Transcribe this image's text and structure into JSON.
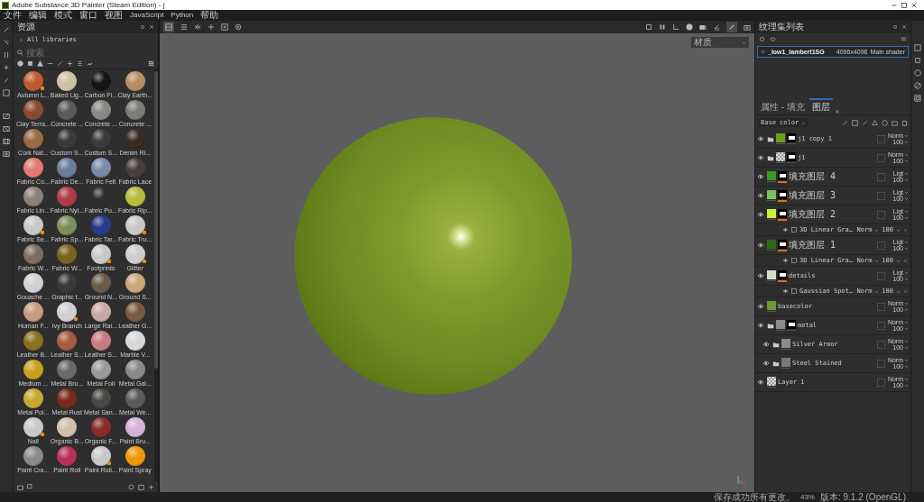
{
  "window": {
    "title": "Adobe Substance 3D Painter (Steam Edition) - j"
  },
  "menu": [
    "文件",
    "编辑",
    "模式",
    "窗口",
    "视图",
    "JavaScript",
    "Python",
    "帮助"
  ],
  "assets": {
    "title": "资源",
    "library": "All libraries",
    "search": {
      "placeholder": "搜索"
    },
    "materials": [
      {
        "name": "Autumn L...",
        "color": "#c05a30",
        "smart": true
      },
      {
        "name": "Baked Lig...",
        "color": "#cfc2a4",
        "smart": false
      },
      {
        "name": "Carbon Fi...",
        "color": "#151515",
        "smart": false
      },
      {
        "name": "Clay Earth...",
        "color": "#b88d66",
        "smart": false
      },
      {
        "name": "Clay Terra...",
        "color": "#8a4a2e",
        "smart": false
      },
      {
        "name": "Concrete ...",
        "color": "#5a5a5e",
        "smart": false
      },
      {
        "name": "Concrete ...",
        "color": "#8a8884",
        "smart": false
      },
      {
        "name": "Concrete ...",
        "color": "#7e7c76",
        "smart": false
      },
      {
        "name": "Cork Nat...",
        "color": "#9a6a42",
        "smart": false
      },
      {
        "name": "Custom S...",
        "color": "#3a3a3a",
        "smart": false
      },
      {
        "name": "Custom S...",
        "color": "#3a3a3a",
        "smart": false
      },
      {
        "name": "Denim Ri...",
        "color": "#3a2a20",
        "smart": false
      },
      {
        "name": "Fabric Co...",
        "color": "#e07a72",
        "smart": false
      },
      {
        "name": "Fabric De...",
        "color": "#6a7e9e",
        "smart": false
      },
      {
        "name": "Fabric Felt",
        "color": "#7a8aa6",
        "smart": false
      },
      {
        "name": "Fabric Lace",
        "color": "#4a3e3c",
        "smart": false
      },
      {
        "name": "Fabric Lin...",
        "color": "#8a807a",
        "smart": false
      },
      {
        "name": "Fabric Nyl...",
        "color": "#b03a4a",
        "smart": false
      },
      {
        "name": "Fabric Pu...",
        "color": "#2e2e2e",
        "smart": false
      },
      {
        "name": "Fabric Rip...",
        "color": "#b8bc3a",
        "smart": false
      },
      {
        "name": "Fabric Se...",
        "color": "#c8c8c8",
        "smart": true
      },
      {
        "name": "Fabric Sp...",
        "color": "#7e8e5a",
        "smart": false
      },
      {
        "name": "Fabric Tar...",
        "color": "#2a3a8a",
        "smart": false
      },
      {
        "name": "Fabric Tru...",
        "color": "#c8c8c8",
        "smart": true
      },
      {
        "name": "Fabric W...",
        "color": "#7a6e66",
        "smart": false
      },
      {
        "name": "Fabric W...",
        "color": "#7a6220",
        "smart": false
      },
      {
        "name": "Footprints",
        "color": "#c8c8c8",
        "smart": true
      },
      {
        "name": "Glitter",
        "color": "#cccccc",
        "smart": true
      },
      {
        "name": "Gouache ...",
        "color": "#d0d0d0",
        "smart": false
      },
      {
        "name": "Graphic t...",
        "color": "#3a3a3a",
        "smart": false
      },
      {
        "name": "Ground N...",
        "color": "#6a5a4a",
        "smart": false
      },
      {
        "name": "Ground S...",
        "color": "#c8a878",
        "smart": false
      },
      {
        "name": "Human F...",
        "color": "#c89a80",
        "smart": false
      },
      {
        "name": "Ivy Branch",
        "color": "#d0d0d0",
        "smart": true
      },
      {
        "name": "Large Rai...",
        "color": "#c8a8a8",
        "smart": false
      },
      {
        "name": "Leather G...",
        "color": "#7a5a42",
        "smart": false
      },
      {
        "name": "Leather B...",
        "color": "#8a7020",
        "smart": false
      },
      {
        "name": "Leather S...",
        "color": "#a85a42",
        "smart": false
      },
      {
        "name": "Leather S...",
        "color": "#c87a82",
        "smart": false
      },
      {
        "name": "Marble V...",
        "color": "#d8d8d8",
        "smart": false
      },
      {
        "name": "Medium ...",
        "color": "#c8a020",
        "smart": false
      },
      {
        "name": "Metal Bru...",
        "color": "#6a6a6a",
        "smart": false
      },
      {
        "name": "Metal Foil",
        "color": "#9a9a9a",
        "smart": false
      },
      {
        "name": "Metal Gal...",
        "color": "#8a8a8a",
        "smart": false
      },
      {
        "name": "Metal Pol...",
        "color": "#c8a830",
        "smart": false
      },
      {
        "name": "Metal Rust",
        "color": "#7a2a1a",
        "smart": false
      },
      {
        "name": "Metal San...",
        "color": "#4a4844",
        "smart": false
      },
      {
        "name": "Metal We...",
        "color": "#5a5a5a",
        "smart": false
      },
      {
        "name": "Nail",
        "color": "#c8c8c8",
        "smart": true
      },
      {
        "name": "Organic B...",
        "color": "#d0c0a8",
        "smart": false
      },
      {
        "name": "Organic F...",
        "color": "#8a2a2a",
        "smart": false
      },
      {
        "name": "Paint Bru...",
        "color": "#d8b0d8",
        "smart": false
      },
      {
        "name": "Paint Cra...",
        "color": "#8a8a8a",
        "smart": false
      },
      {
        "name": "Paint Roll",
        "color": "#b8305a",
        "smart": false
      },
      {
        "name": "Paint Roll...",
        "color": "#c8c8c8",
        "smart": true
      },
      {
        "name": "Paint Spray",
        "color": "#f0980a",
        "smart": false
      }
    ]
  },
  "viewport": {
    "display_mode": "材质"
  },
  "texture_sets": {
    "title": "纹理集列表",
    "items": [
      {
        "name": "_low1_lambert1SG",
        "resolution": "4096x4096",
        "shader": "Main shader",
        "selected": true
      }
    ]
  },
  "layers_panel": {
    "tabs": [
      {
        "label": "属性 - 填充",
        "selected": false
      },
      {
        "label": "图层",
        "selected": true
      }
    ],
    "channel": "Base color",
    "layers": [
      {
        "name": "j1 copy 1",
        "kind": "folder",
        "visible": true,
        "color": "#6aa020",
        "mask": true,
        "blend": "Norm",
        "opacity": "100"
      },
      {
        "name": "j1",
        "kind": "folder",
        "visible": true,
        "mask": true,
        "blend": "Norm",
        "opacity": "100"
      },
      {
        "name": "填充图层 4",
        "kind": "fill",
        "visible": true,
        "color": "#3a9a20",
        "mask": true,
        "blend": "Ligt",
        "opacity": "100"
      },
      {
        "name": "填充图层 3",
        "kind": "fill",
        "visible": true,
        "color": "#7ac060",
        "mask": true,
        "blend": "Ligt",
        "opacity": "100"
      },
      {
        "name": "填充图层 2",
        "kind": "fill",
        "visible": true,
        "color": "#c8f040",
        "mask": true,
        "blend": "Ligt",
        "opacity": "100",
        "effects": [
          {
            "name": "3D Linear Gra…",
            "blend": "Norm",
            "opacity": "100"
          }
        ]
      },
      {
        "name": "填充图层 1",
        "kind": "fill",
        "visible": true,
        "color": "#2e6a18",
        "mask": true,
        "blend": "Ligt",
        "opacity": "100",
        "effects": [
          {
            "name": "3D Linear Gra…",
            "blend": "Norm",
            "opacity": "100"
          }
        ]
      },
      {
        "name": "details",
        "kind": "fill",
        "visible": true,
        "color": "#d0e0c0",
        "mask": true,
        "blend": "Ligt",
        "opacity": "100",
        "effects": [
          {
            "name": "Gaussian Spot…",
            "blend": "Norm",
            "opacity": "100"
          }
        ]
      },
      {
        "name": "basecolor",
        "kind": "fill",
        "visible": true,
        "color": "#6a9a30",
        "mask": false,
        "blend": "Norm",
        "opacity": "100"
      },
      {
        "name": "metal",
        "kind": "folder",
        "visible": true,
        "color": "#8a8a8a",
        "mask": true,
        "blend": "Norm",
        "opacity": "100",
        "children": [
          {
            "name": "Silver Armor",
            "kind": "folder",
            "visible": true,
            "color": "#8a8a8a",
            "mask": false,
            "blend": "Norm",
            "opacity": "100"
          },
          {
            "name": "Steel Stained",
            "kind": "folder",
            "visible": true,
            "color": "#7a7a7a",
            "mask": false,
            "blend": "Norm",
            "opacity": "100"
          }
        ]
      },
      {
        "name": "Layer 1",
        "kind": "paint",
        "visible": true,
        "mask": false,
        "blend": "Norm",
        "opacity": "100"
      }
    ]
  },
  "status_bar": {
    "message": "保存成功所有更改。",
    "progress": "43%",
    "version": "版本: 9.1.2 (OpenGL)"
  }
}
